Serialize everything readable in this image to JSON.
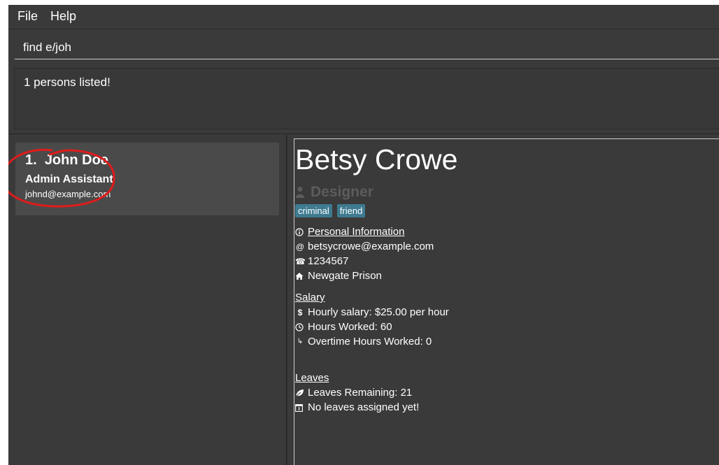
{
  "menu": {
    "file": "File",
    "help": "Help"
  },
  "command": {
    "value": "find e/joh"
  },
  "result": {
    "message": "1 persons listed!"
  },
  "person_list": [
    {
      "index": "1.",
      "name": "John Doe",
      "role": "Admin Assistant",
      "email": "johnd@example.com"
    }
  ],
  "detail": {
    "name": "Betsy Crowe",
    "role": "Designer",
    "tags": [
      "criminal",
      "friend"
    ],
    "personal_title": "Personal Information",
    "email": "betsycrowe@example.com",
    "phone": "1234567",
    "address": "Newgate Prison",
    "salary_title": "Salary",
    "hourly_salary": "Hourly salary: $25.00 per hour",
    "hours_worked": "Hours Worked: 60",
    "overtime": "Overtime Hours Worked: 0",
    "leaves_title": "Leaves",
    "leaves_remaining": "Leaves Remaining: 21",
    "leaves_assigned": "No leaves assigned yet!"
  },
  "colors": {
    "background": "#3a3a3a",
    "card": "#4a4a4a",
    "tag": "#3e7b91",
    "annotation": "#e01b1b"
  }
}
